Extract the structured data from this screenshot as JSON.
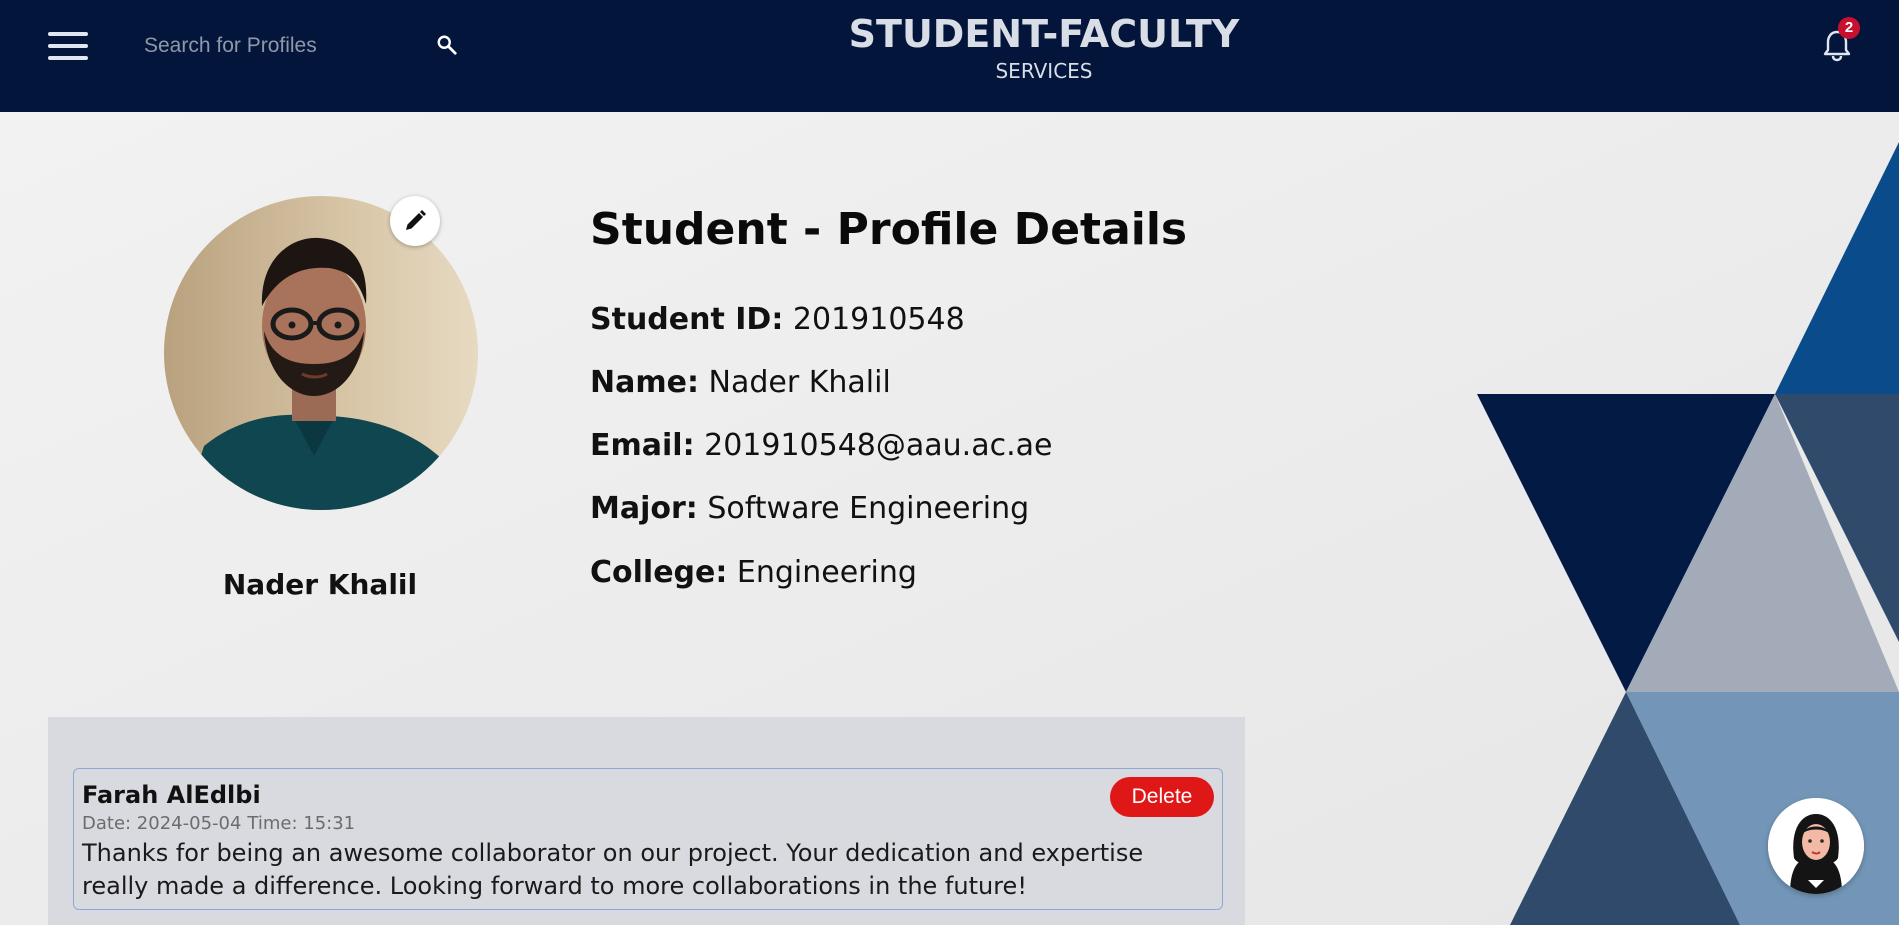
{
  "header": {
    "search": {
      "placeholder": "Search for Profiles",
      "value": ""
    },
    "brand_title": "STUDENT-FACULTY",
    "brand_subtitle": "SERVICES",
    "notification_count": "2",
    "icons": [
      "menu-icon",
      "search-icon",
      "bell-icon"
    ]
  },
  "profile": {
    "display_name": "Nader Khalil",
    "heading": "Student - Profile Details",
    "fields": [
      {
        "label": "Student ID:",
        "value": "201910548"
      },
      {
        "label": "Name:",
        "value": "Nader Khalil"
      },
      {
        "label": "Email:",
        "value": "201910548@aau.ac.ae"
      },
      {
        "label": "Major:",
        "value": "Software Engineering"
      },
      {
        "label": "College:",
        "value": "Engineering"
      }
    ]
  },
  "comments": [
    {
      "author": "Farah AlEdlbi",
      "date": "Date: 2024-05-04",
      "time": "Time: 15:31",
      "text": "Thanks for being an awesome collaborator on our project. Your dedication and expertise really made a difference. Looking forward to more collaborations in the future!",
      "delete_label": "Delete"
    }
  ],
  "colors": {
    "header_bg": "#03153a",
    "delete_button": "#e01717",
    "badge": "#c8102e",
    "deco_navy": "#031a45",
    "deco_blue": "#0a4b8c",
    "deco_slate": "#2f4a6b",
    "deco_grey": "#a4abb8",
    "deco_light_blue": "#7396b8"
  }
}
